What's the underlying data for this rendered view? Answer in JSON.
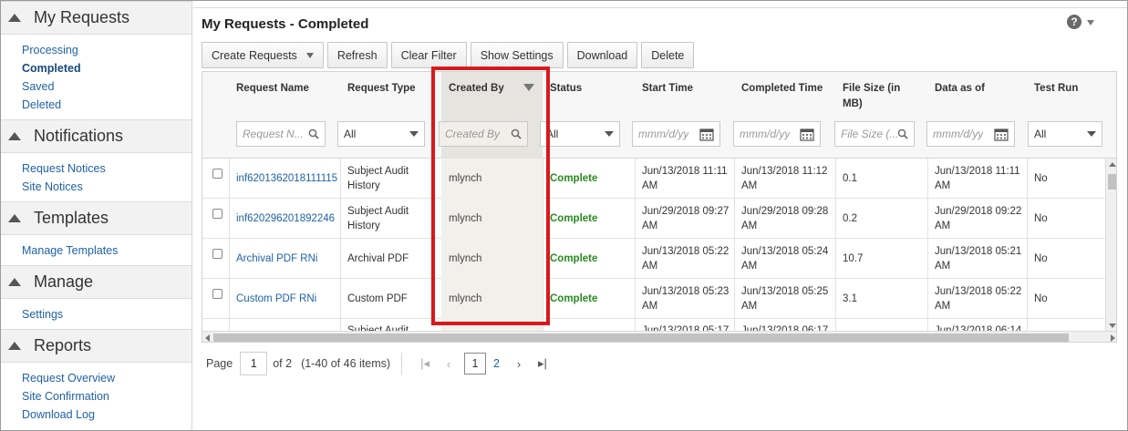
{
  "sidebar": {
    "sections": [
      {
        "title": "My Requests",
        "items": [
          "Processing",
          "Completed",
          "Saved",
          "Deleted"
        ],
        "active": "Completed"
      },
      {
        "title": "Notifications",
        "items": [
          "Request Notices",
          "Site Notices"
        ]
      },
      {
        "title": "Templates",
        "items": [
          "Manage Templates"
        ]
      },
      {
        "title": "Manage",
        "items": [
          "Settings"
        ]
      },
      {
        "title": "Reports",
        "items": [
          "Request Overview",
          "Site Confirmation",
          "Download Log"
        ]
      }
    ]
  },
  "header": {
    "title": "My Requests - Completed",
    "help_symbol": "?"
  },
  "toolbar": {
    "create_requests": "Create Requests",
    "refresh": "Refresh",
    "clear_filter": "Clear Filter",
    "show_settings": "Show Settings",
    "download": "Download",
    "delete": "Delete"
  },
  "table": {
    "columns": [
      "Request Name",
      "Request Type",
      "Created By",
      "Status",
      "Start Time",
      "Completed Time",
      "File Size (in MB)",
      "Data as of",
      "Test Run"
    ],
    "filters": {
      "request_name": "Request N...",
      "request_type": "All",
      "created_by": "Created By",
      "status": "All",
      "start_time": "mmm/d/yy",
      "completed_time": "mmm/d/yy",
      "file_size": "File Size (...",
      "data_as_of": "mmm/d/yy",
      "test_run": "All"
    },
    "rows": [
      {
        "name": "inf6201362018111115",
        "type": "Subject Audit History",
        "created_by": "mlynch",
        "status": "Complete",
        "start": "Jun/13/2018 11:11 AM",
        "completed": "Jun/13/2018 11:12 AM",
        "size": "0.1",
        "data_as_of": "Jun/13/2018 11:11 AM",
        "test_run": "No"
      },
      {
        "name": "inf620296201892246",
        "type": "Subject Audit History",
        "created_by": "mlynch",
        "status": "Complete",
        "start": "Jun/29/2018 09:27 AM",
        "completed": "Jun/29/2018 09:28 AM",
        "size": "0.2",
        "data_as_of": "Jun/29/2018 09:22 AM",
        "test_run": "No"
      },
      {
        "name": "Archival PDF RNi",
        "type": "Archival PDF",
        "created_by": "mlynch",
        "status": "Complete",
        "start": "Jun/13/2018 05:22 AM",
        "completed": "Jun/13/2018 05:24 AM",
        "size": "10.7",
        "data_as_of": "Jun/13/2018 05:21 AM",
        "test_run": "No"
      },
      {
        "name": "Custom PDF RNi",
        "type": "Custom PDF",
        "created_by": "mlynch",
        "status": "Complete",
        "start": "Jun/13/2018 05:23 AM",
        "completed": "Jun/13/2018 05:25 AM",
        "size": "3.1",
        "data_as_of": "Jun/13/2018 05:22 AM",
        "test_run": "No"
      },
      {
        "name": "",
        "type": "Subject Audit",
        "created_by": "",
        "status": "",
        "start": "Jun/13/2018 05:17",
        "completed": "Jun/13/2018 06:17",
        "size": "",
        "data_as_of": "Jun/13/2018 06:14",
        "test_run": ""
      }
    ]
  },
  "pagination": {
    "page_label": "Page",
    "current_page": "1",
    "of_label": "of 2",
    "items_summary": "(1-40 of 46 items)",
    "pages": [
      "1",
      "2"
    ]
  },
  "colors": {
    "accent_link": "#1f61a8",
    "status_complete": "#2a8a1e",
    "highlight": "#d8191c"
  }
}
